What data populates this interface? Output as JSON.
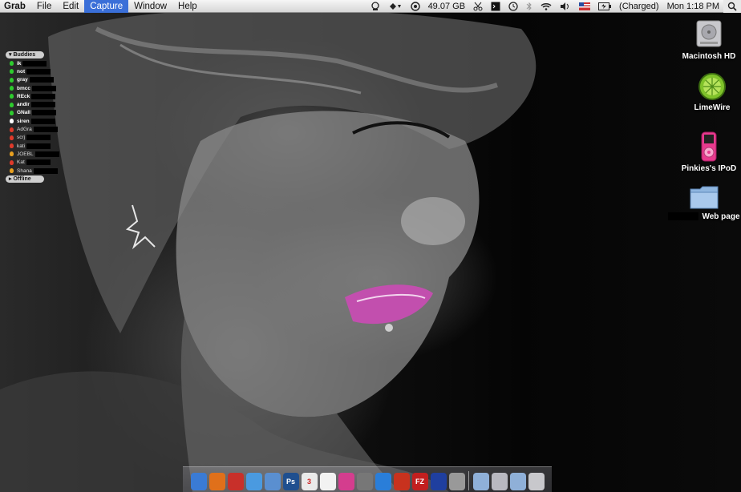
{
  "menubar": {
    "app_name": "Grab",
    "menus": [
      "File",
      "Edit",
      "Capture",
      "Window",
      "Help"
    ],
    "active_menu": "Capture",
    "disk_space": "49.07 GB",
    "battery_status": "(Charged)",
    "clock": "Mon 1:18 PM"
  },
  "buddy_list": {
    "group_online": "Buddies",
    "group_offline": "Offline",
    "buddies": [
      {
        "name": "ik",
        "status": "available",
        "color": "#2ecc2e"
      },
      {
        "name": "not",
        "status": "available",
        "color": "#2ecc2e"
      },
      {
        "name": "gray",
        "status": "available",
        "color": "#2ecc2e"
      },
      {
        "name": "bmcc",
        "status": "available",
        "color": "#2ecc2e"
      },
      {
        "name": "REck",
        "status": "available",
        "color": "#2ecc2e"
      },
      {
        "name": "andir",
        "status": "available",
        "color": "#2ecc2e"
      },
      {
        "name": "GNall",
        "status": "available",
        "color": "#2ecc2e"
      },
      {
        "name": "siren",
        "status": "available",
        "color": "#ffffff"
      },
      {
        "name": "AdGra",
        "status": "away",
        "color": "#e03a2a"
      },
      {
        "name": "scrj",
        "status": "away",
        "color": "#e03a2a"
      },
      {
        "name": "kati",
        "status": "away",
        "color": "#e03a2a"
      },
      {
        "name": "JOEBL",
        "status": "away",
        "color": "#e8a020"
      },
      {
        "name": "Kat",
        "status": "away",
        "color": "#e03a2a"
      },
      {
        "name": "Shana",
        "status": "away",
        "color": "#e8a020"
      }
    ]
  },
  "desktop_icons": {
    "hd": "Macintosh HD",
    "limewire": "LimeWire",
    "ipod": "Pinkies's IPoD",
    "webpage": "Web page"
  },
  "dock": {
    "apps": [
      {
        "icon": "finder-icon",
        "color": "#3a7bd5"
      },
      {
        "icon": "firefox-icon",
        "color": "#e0701a"
      },
      {
        "icon": "adium-icon",
        "color": "#c8302a"
      },
      {
        "icon": "itunes-icon",
        "color": "#4a9ae0"
      },
      {
        "icon": "safari-icon",
        "color": "#5a8fd0"
      },
      {
        "icon": "photoshop-icon",
        "color": "#1f4f8f",
        "label": "Ps"
      },
      {
        "icon": "ical-icon",
        "color": "#eaeaea",
        "label": "3"
      },
      {
        "icon": "textedit-icon",
        "color": "#f2f2f2"
      },
      {
        "icon": "pinkapp-icon",
        "color": "#d43d8e"
      },
      {
        "icon": "itunes2-icon",
        "color": "#777777"
      },
      {
        "icon": "quicktime-icon",
        "color": "#2a7ed9"
      },
      {
        "icon": "tomato-icon",
        "color": "#c8321e"
      },
      {
        "icon": "filezilla-icon",
        "color": "#c21f1f",
        "label": "FZ"
      },
      {
        "icon": "bluefish-icon",
        "color": "#1f3f9f"
      },
      {
        "icon": "preview-icon",
        "color": "#999999"
      }
    ],
    "stacks": [
      {
        "icon": "folder-icon",
        "color": "#8fb0d8"
      },
      {
        "icon": "downloads-icon",
        "color": "#b8b8c0"
      },
      {
        "icon": "folder2-icon",
        "color": "#8fb0d8"
      },
      {
        "icon": "trash-icon",
        "color": "#c8c8cc"
      }
    ]
  }
}
